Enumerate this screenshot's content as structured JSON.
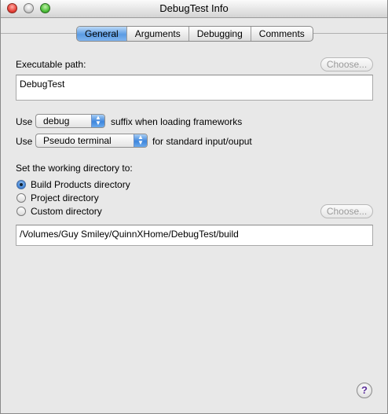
{
  "window": {
    "title": "DebugTest Info"
  },
  "tabs": [
    "General",
    "Arguments",
    "Debugging",
    "Comments"
  ],
  "active_tab": "General",
  "executable": {
    "label": "Executable path:",
    "choose_label": "Choose...",
    "value": "DebugTest"
  },
  "frameworks": {
    "use_label": "Use",
    "selected": "debug",
    "suffix_text": "suffix when loading frameworks"
  },
  "io": {
    "use_label": "Use",
    "selected": "Pseudo terminal",
    "suffix_text": "for standard input/ouput"
  },
  "working_dir": {
    "label": "Set the working directory to:",
    "options": [
      "Build Products directory",
      "Project directory",
      "Custom directory"
    ],
    "selected": "Build Products directory",
    "choose_label": "Choose...",
    "path": "/Volumes/Guy Smiley/QuinnXHome/DebugTest/build"
  },
  "help": {
    "glyph": "?"
  }
}
